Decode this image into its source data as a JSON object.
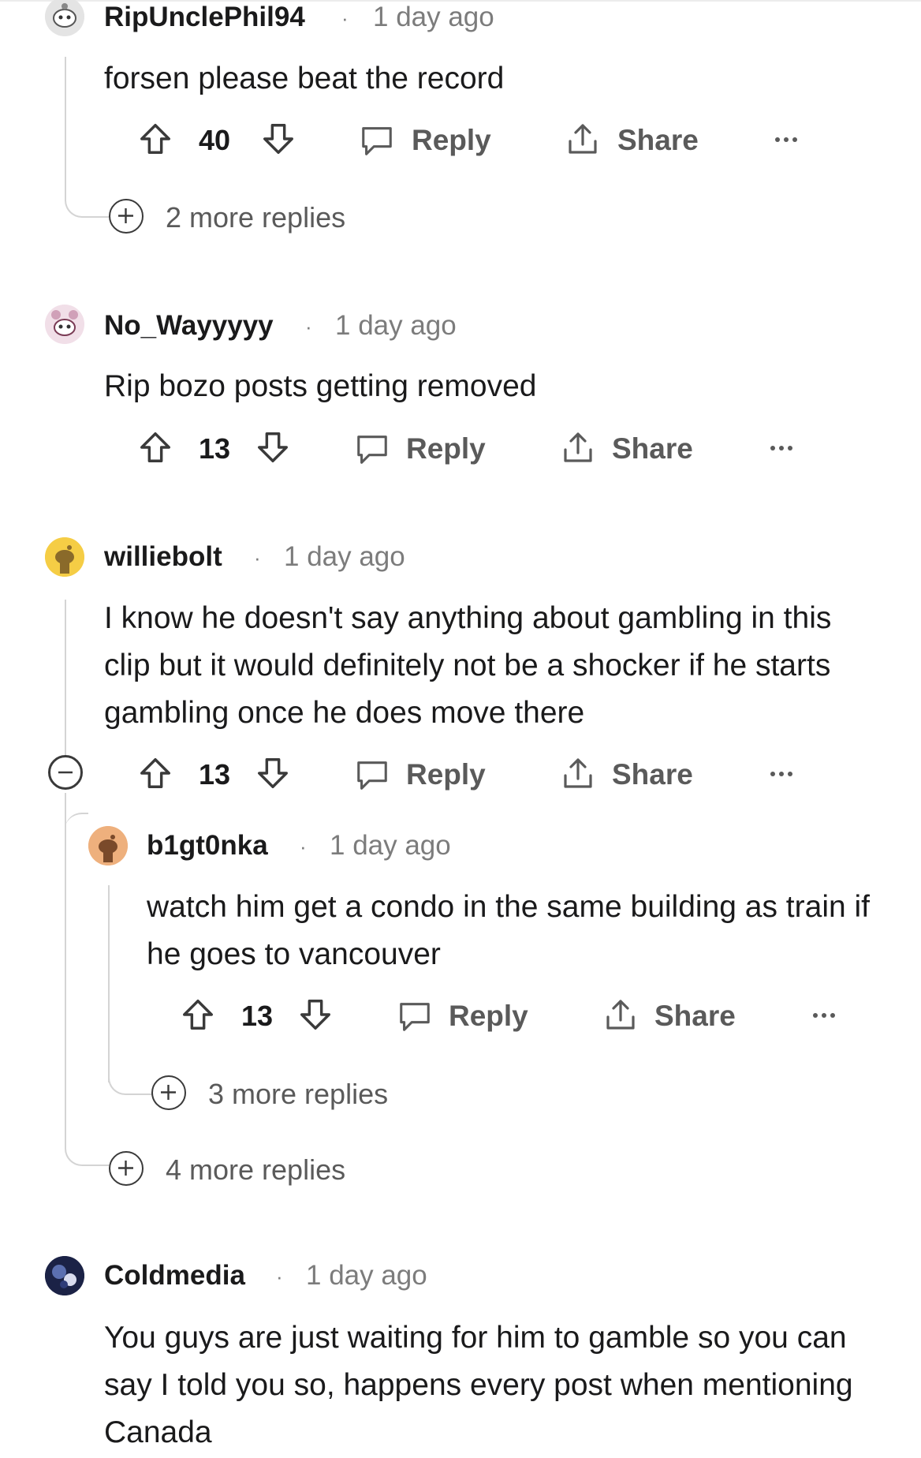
{
  "comments": [
    {
      "author": "RipUnclePhil94",
      "separator": "·",
      "time": "1 day ago",
      "body": "forsen please beat the record",
      "votes": "40",
      "reply_label": "Reply",
      "share_label": "Share",
      "more_replies": "2 more replies"
    },
    {
      "author": "No_Wayyyyy",
      "separator": "·",
      "time": "1 day ago",
      "body": "Rip bozo posts getting removed",
      "votes": "13",
      "reply_label": "Reply",
      "share_label": "Share"
    },
    {
      "author": "williebolt",
      "separator": "·",
      "time": "1 day ago",
      "body": "I know he doesn't say anything about gambling in this clip but it would definitely not be a shocker if he starts gambling once he does move there",
      "votes": "13",
      "reply_label": "Reply",
      "share_label": "Share",
      "more_replies": "4 more replies",
      "replies": [
        {
          "author": "b1gt0nka",
          "separator": "·",
          "time": "1 day ago",
          "body": "watch him get a condo in the same building as train if he goes to vancouver",
          "votes": "13",
          "reply_label": "Reply",
          "share_label": "Share",
          "more_replies": "3 more replies"
        }
      ]
    },
    {
      "author": "Coldmedia",
      "separator": "·",
      "time": "1 day ago",
      "body": "You guys are just waiting for him to gamble so you can say I told you so, happens every post when mentioning Canada"
    }
  ]
}
